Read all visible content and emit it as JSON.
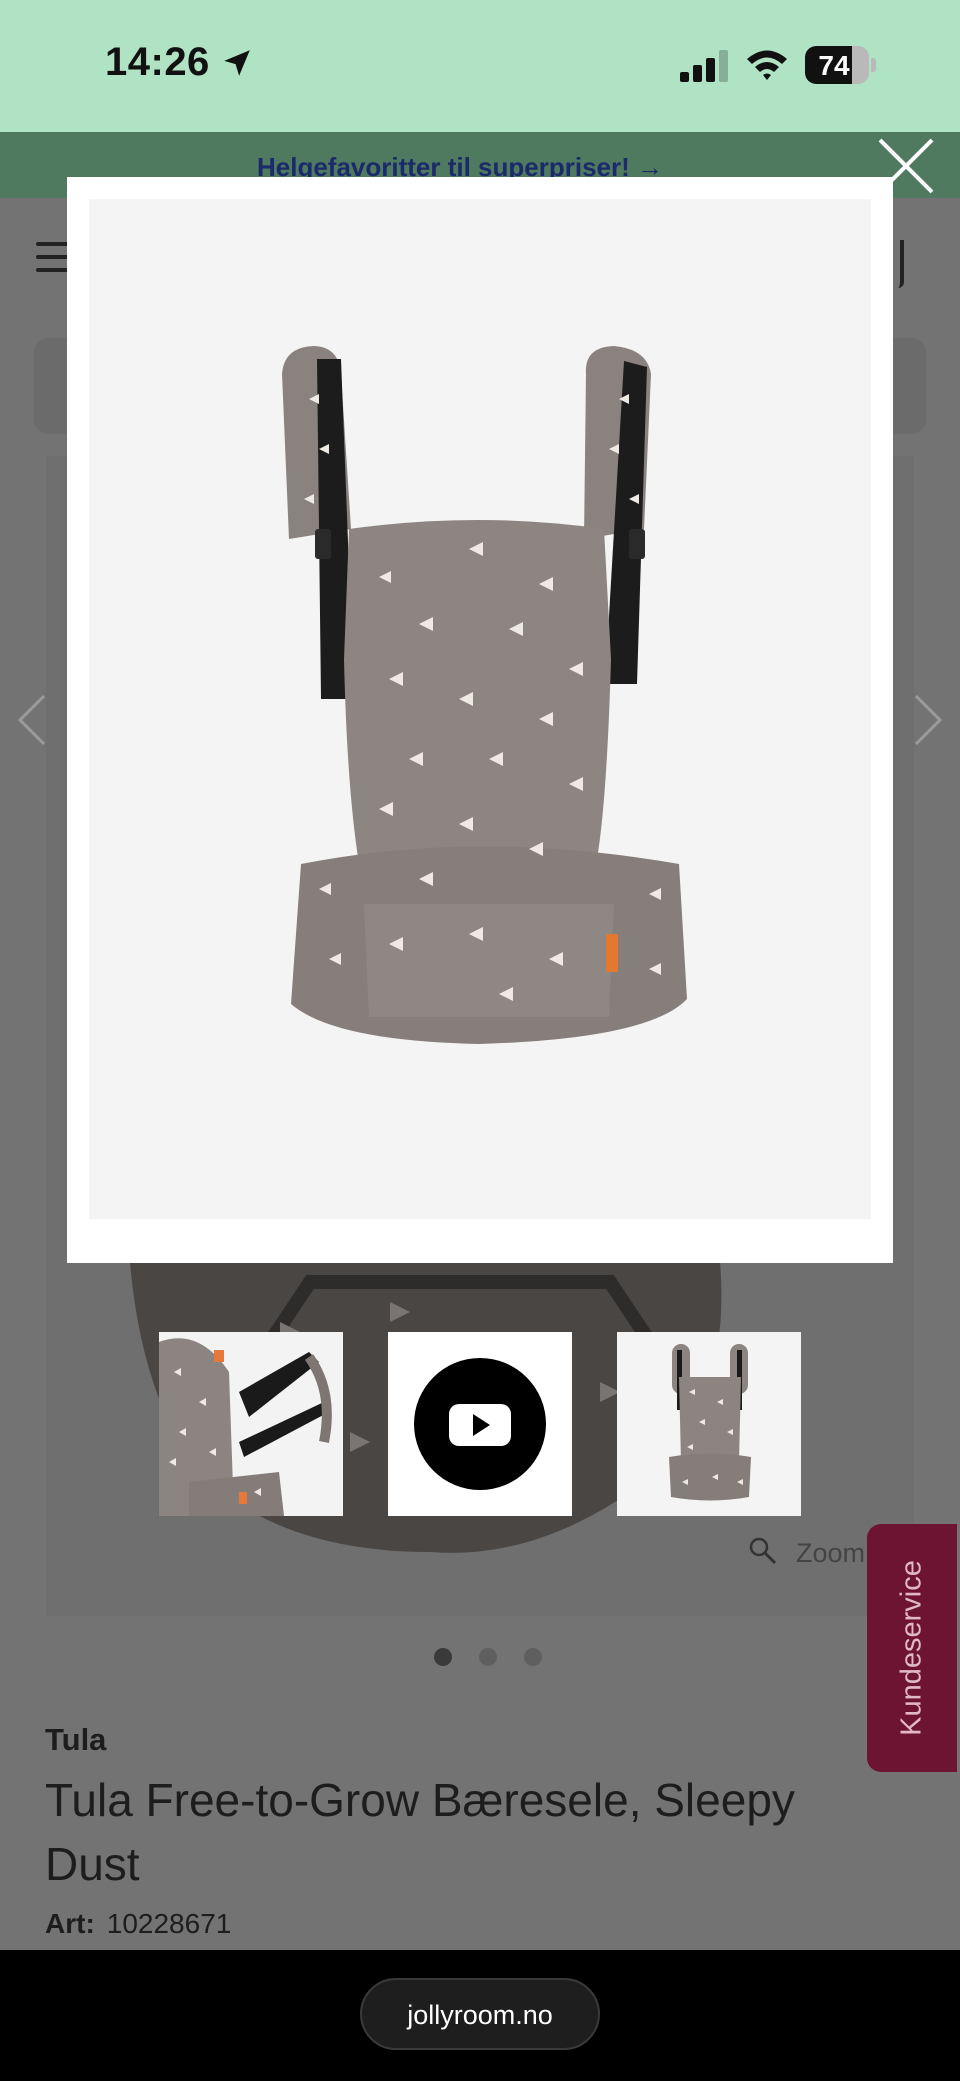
{
  "status_bar": {
    "time": "14:26",
    "battery_level": "74"
  },
  "promo": {
    "text": "Helgefavoritter til superpriser! →"
  },
  "gallery": {
    "zoom_label": "Zoom",
    "dots": {
      "count": 3,
      "active_index": 0
    }
  },
  "product": {
    "brand": "Tula",
    "title": "Tula Free-to-Grow Bæresele, Sleepy Dust",
    "art_label": "Art:",
    "art_number": "10228671"
  },
  "kundeservice": {
    "label": "Kundeservice"
  },
  "browser": {
    "url": "jollyroom.no"
  },
  "colors": {
    "status_bar_bg": "#afe3c3",
    "kundeservice_bg": "#6e1433",
    "carrier_fabric": "#8c8481"
  },
  "icons": {
    "close": "close-icon",
    "youtube": "youtube-icon",
    "zoom": "magnifier-icon",
    "prev": "chevron-left-icon",
    "next": "chevron-right-icon"
  }
}
